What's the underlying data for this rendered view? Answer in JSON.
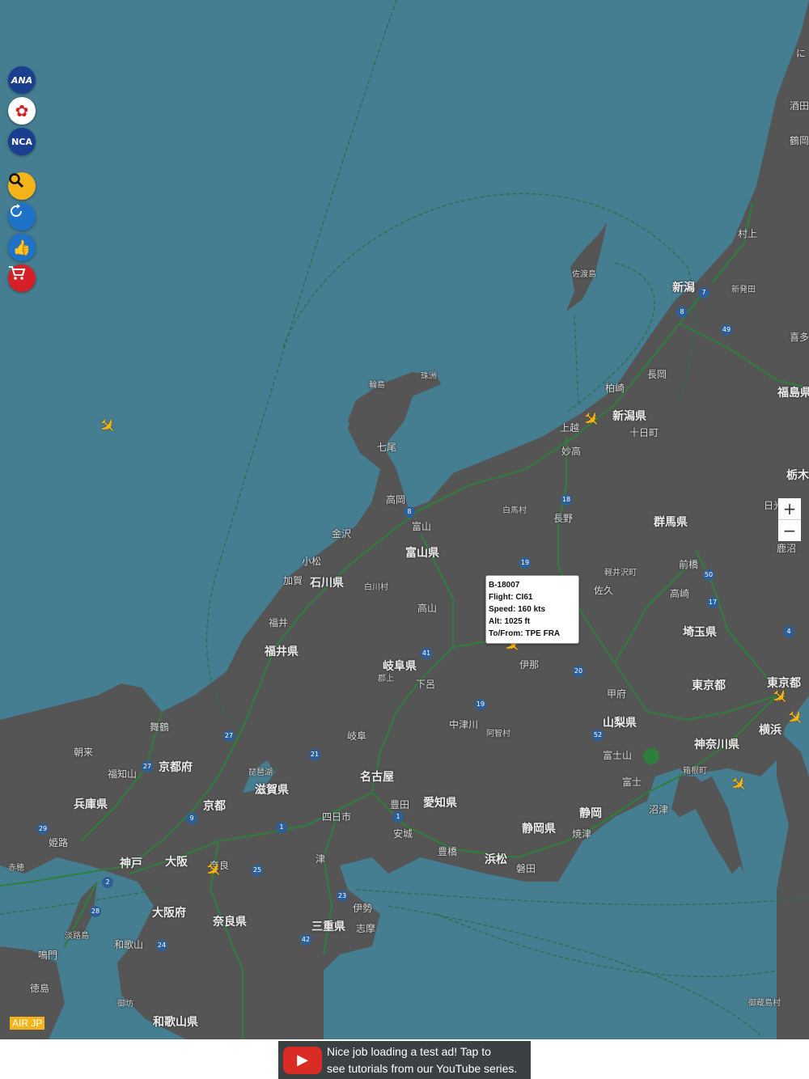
{
  "map": {
    "water_color": "#457d91",
    "land_color": "#555555",
    "road_color": "#2f7f3c",
    "route_color": "#2e6f4f",
    "prefectures": [
      "新潟県",
      "富山県",
      "石川県",
      "福井県",
      "岐阜県",
      "長野県",
      "群馬県",
      "埼玉県",
      "東京都",
      "神奈川県",
      "山梨県",
      "静岡県",
      "愛知県",
      "三重県",
      "滋賀県",
      "京都府",
      "兵庫県",
      "大阪府",
      "奈良県",
      "和歌山県",
      "福島県"
    ],
    "cities": [
      "新潟",
      "長岡",
      "柏崎",
      "上越",
      "妙高",
      "十日町",
      "佐渡島",
      "輪島",
      "珠洲",
      "七尾",
      "金沢",
      "小松",
      "加賀",
      "富山",
      "高岡",
      "福井",
      "高山",
      "郡上",
      "下呂",
      "岐阜",
      "名古屋",
      "豊田",
      "安城",
      "豊橋",
      "浜松",
      "磐田",
      "静岡",
      "焼津",
      "沼津",
      "富士",
      "富士山",
      "箱根町",
      "横浜",
      "甲府",
      "伊那",
      "中津川",
      "阿智村",
      "長野",
      "白馬村",
      "軽井沢町",
      "佐久",
      "前橋",
      "高崎",
      "四日市",
      "津",
      "伊勢",
      "志摩",
      "京都",
      "大阪",
      "神戸",
      "奈良",
      "姫路",
      "淡路島",
      "徳島",
      "鳴門",
      "御坊",
      "和歌山",
      "福知山",
      "舞鶴",
      "朝来",
      "赤穂",
      "新発田",
      "村上",
      "酒田",
      "鶴岡",
      "喜多",
      "栃木",
      "日光",
      "鹿沼",
      "琵琶湖",
      "白川村",
      "御蔵島村"
    ],
    "road_numbers": [
      "7",
      "8",
      "49",
      "18",
      "19",
      "41",
      "19",
      "20",
      "52",
      "17",
      "50",
      "4",
      "1",
      "21",
      "8",
      "27",
      "27",
      "9",
      "29",
      "2",
      "28",
      "24",
      "42",
      "23",
      "25",
      "1"
    ]
  },
  "airline_buttons": [
    {
      "name": "ANA",
      "color": "#1b3f8f"
    },
    {
      "name": "JAL",
      "color": "#d52027"
    },
    {
      "name": "NCA",
      "color": "#1b3f8f"
    }
  ],
  "tool_buttons": [
    {
      "icon": "search-icon",
      "color": "#f2b31b"
    },
    {
      "icon": "refresh-icon",
      "color": "#1e73c8"
    },
    {
      "icon": "thumbs-up-icon",
      "color": "#1e73c8"
    },
    {
      "icon": "cart-icon",
      "color": "#d52027"
    }
  ],
  "zoom": {
    "in_label": "+",
    "out_label": "−"
  },
  "popup": {
    "registration": "B-18007",
    "flight": "Flight: CI61",
    "speed": "Speed: 160 kts",
    "alt": "Alt: 1025 ft",
    "route": "To/From: TPE FRA"
  },
  "brand": "AIR JP",
  "ad": {
    "text_line1": "Nice job loading a test ad!  Tap to",
    "text_line2": "see tutorials from our YouTube series."
  },
  "edge_labels": [
    "に",
    "酒田",
    "鶴岡",
    "村上",
    "喜多",
    "福島県",
    "栃木",
    "日",
    "鹿沼"
  ]
}
